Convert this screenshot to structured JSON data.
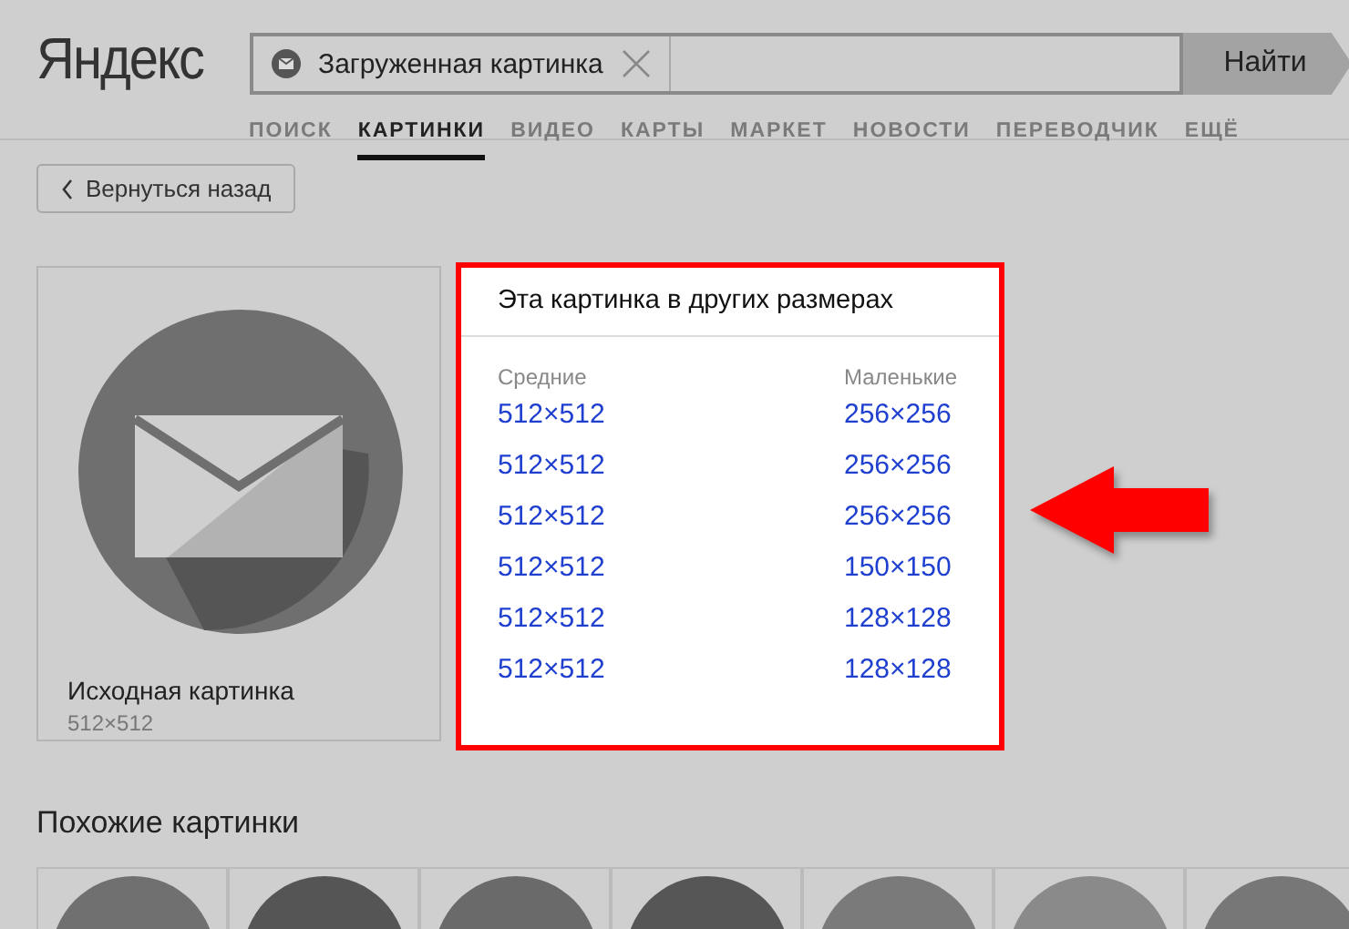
{
  "logo": "Яндекс",
  "search": {
    "chip": "Загруженная картинка",
    "button": "Найти"
  },
  "tabs": [
    {
      "label": "ПОИСК",
      "selected": false
    },
    {
      "label": "КАРТИНКИ",
      "selected": true
    },
    {
      "label": "ВИДЕО",
      "selected": false
    },
    {
      "label": "КАРТЫ",
      "selected": false
    },
    {
      "label": "МАРКЕТ",
      "selected": false
    },
    {
      "label": "НОВОСТИ",
      "selected": false
    },
    {
      "label": "ПЕРЕВОДЧИК",
      "selected": false
    },
    {
      "label": "ЕЩЁ",
      "selected": false
    }
  ],
  "back_button": "Вернуться назад",
  "original": {
    "title": "Исходная картинка",
    "size": "512×512"
  },
  "sizes_panel": {
    "title": "Эта картинка в других размерах",
    "columns": [
      "Средние",
      "Маленькие"
    ],
    "rows": [
      [
        "512×512",
        "256×256"
      ],
      [
        "512×512",
        "256×256"
      ],
      [
        "512×512",
        "256×256"
      ],
      [
        "512×512",
        "150×150"
      ],
      [
        "512×512",
        "128×128"
      ],
      [
        "512×512",
        "128×128"
      ]
    ]
  },
  "similar": {
    "title": "Похожие картинки",
    "thumbnails": [
      {
        "color": "#707070"
      },
      {
        "color": "#555555"
      },
      {
        "color": "#6a6a6a"
      },
      {
        "color": "#565656"
      },
      {
        "color": "#7a7a7a"
      },
      {
        "color": "#8a8a8a"
      },
      {
        "color": "#777777"
      }
    ]
  }
}
